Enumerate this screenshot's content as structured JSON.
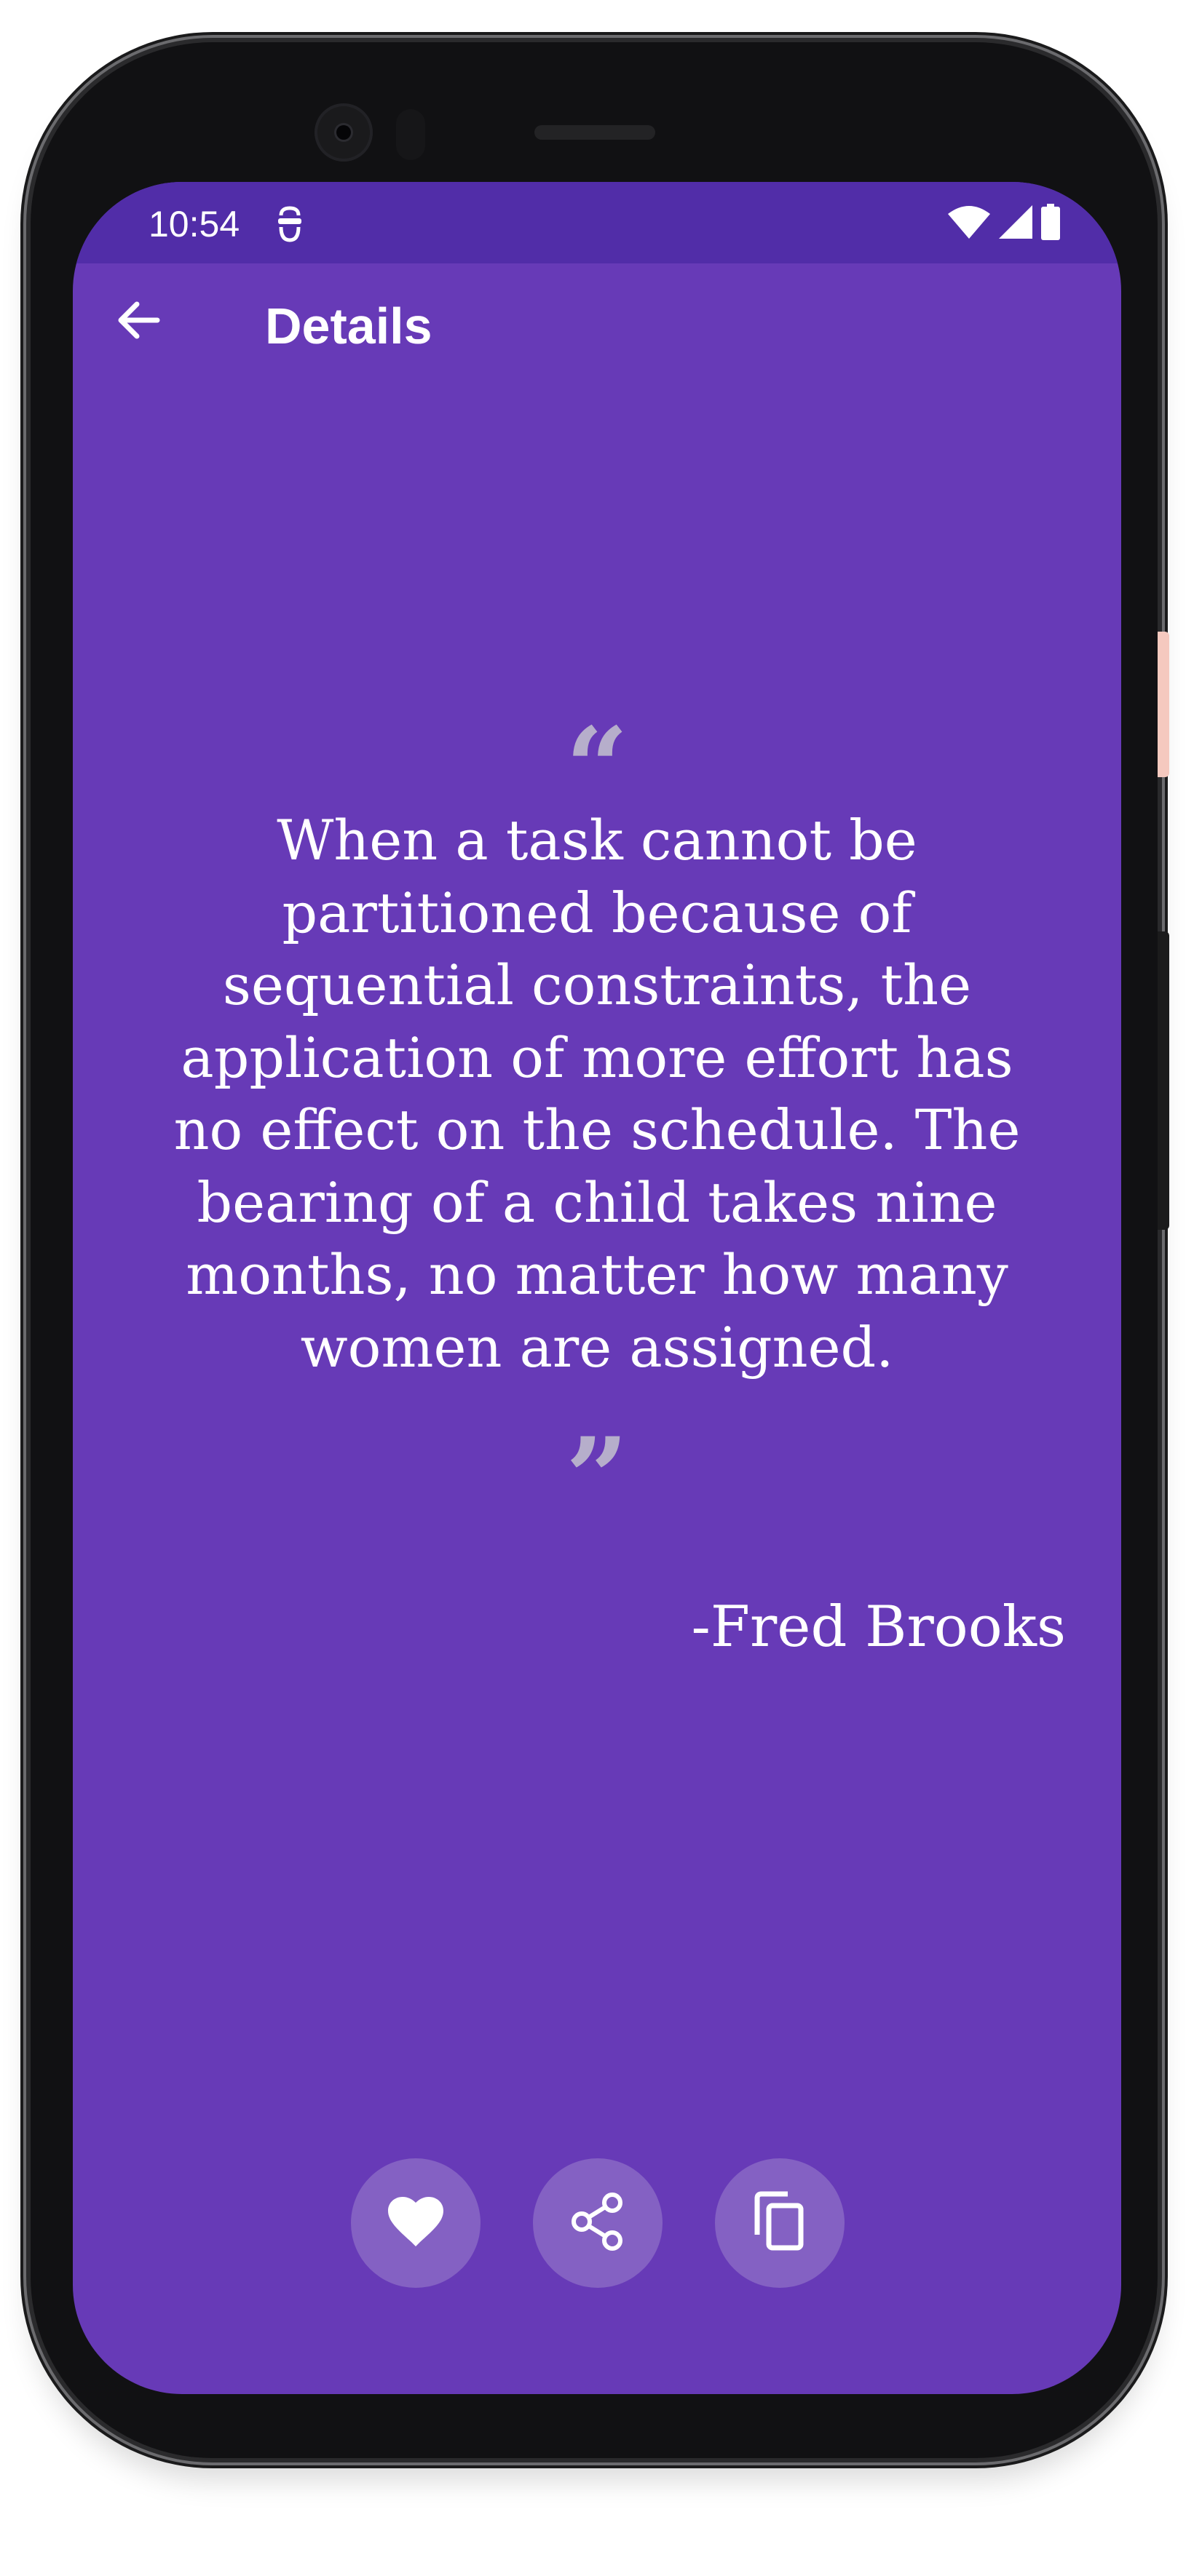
{
  "status_bar": {
    "time": "10:54",
    "notification_icon": "privacy-indicator-icon",
    "icons": [
      "wifi-icon",
      "cell-signal-icon",
      "battery-icon"
    ]
  },
  "toolbar": {
    "back_icon": "arrow-back-icon",
    "title": "Details"
  },
  "quote": {
    "open_mark": "“",
    "text": "When a task cannot be partitioned because of sequential constraints, the application of more effort has no effect on the schedule. The bearing of a child takes nine months, no matter how many women are assigned.",
    "close_mark": "”",
    "author": "-Fred Brooks"
  },
  "actions": [
    {
      "icon": "heart-icon",
      "action": "favorite"
    },
    {
      "icon": "share-icon",
      "action": "share"
    },
    {
      "icon": "copy-icon",
      "action": "copy"
    }
  ],
  "colors": {
    "background": "#673AB7",
    "status_bar": "#512DA8",
    "quote_marks": "#B6AECB",
    "action_button": "#8461C3",
    "text": "#FFFFFF"
  }
}
